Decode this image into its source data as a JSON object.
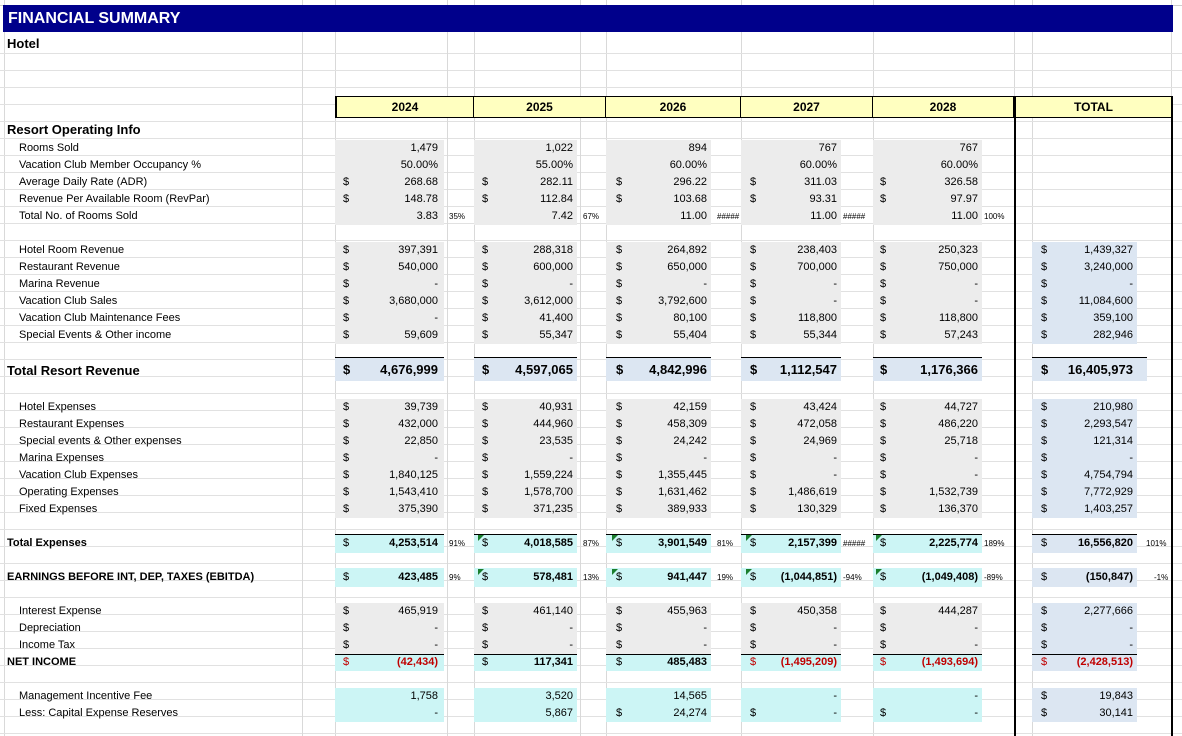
{
  "title": "FINANCIAL SUMMARY",
  "subtitle": "Hotel",
  "years": [
    "2024",
    "2025",
    "2026",
    "2027",
    "2028"
  ],
  "total_label": "TOTAL",
  "currency": "$",
  "section_operating": "Resort Operating Info",
  "operating": [
    {
      "label": "Rooms Sold",
      "values": [
        "1,479",
        "1,022",
        "894",
        "767",
        "767"
      ],
      "cur": false
    },
    {
      "label": "Vacation Club Member Occupancy %",
      "values": [
        "50.00%",
        "55.00%",
        "60.00%",
        "60.00%",
        "60.00%"
      ],
      "cur": false
    },
    {
      "label": "Average Daily Rate (ADR)",
      "values": [
        "268.68",
        "282.11",
        "296.22",
        "311.03",
        "326.58"
      ],
      "cur": true
    },
    {
      "label": "Revenue Per Available Room (RevPar)",
      "values": [
        "148.78",
        "112.84",
        "103.68",
        "93.31",
        "97.97"
      ],
      "cur": true
    },
    {
      "label": "Total No. of Rooms Sold",
      "values": [
        "3.83",
        "7.42",
        "11.00",
        "11.00",
        "11.00"
      ],
      "cur": false,
      "pcts": [
        "35%",
        "67%",
        "#####",
        "#####",
        "100%"
      ]
    }
  ],
  "revenue": [
    {
      "label": "Hotel Room Revenue",
      "values": [
        "397,391",
        "288,318",
        "264,892",
        "238,403",
        "250,323"
      ],
      "total": "1,439,327"
    },
    {
      "label": "Restaurant Revenue",
      "values": [
        "540,000",
        "600,000",
        "650,000",
        "700,000",
        "750,000"
      ],
      "total": "3,240,000"
    },
    {
      "label": "Marina Revenue",
      "values": [
        "-",
        "-",
        "-",
        "-",
        "-"
      ],
      "total": "-"
    },
    {
      "label": "Vacation Club Sales",
      "values": [
        "3,680,000",
        "3,612,000",
        "3,792,600",
        "-",
        "-"
      ],
      "total": "11,084,600"
    },
    {
      "label": "Vacation Club Maintenance Fees",
      "values": [
        "-",
        "41,400",
        "80,100",
        "118,800",
        "118,800"
      ],
      "total": "359,100"
    },
    {
      "label": "Special Events & Other income",
      "values": [
        "59,609",
        "55,347",
        "55,404",
        "55,344",
        "57,243"
      ],
      "total": "282,946"
    }
  ],
  "total_revenue": {
    "label": "Total Resort Revenue",
    "values": [
      "4,676,999",
      "4,597,065",
      "4,842,996",
      "1,112,547",
      "1,176,366"
    ],
    "total": "16,405,973"
  },
  "expenses": [
    {
      "label": "Hotel Expenses",
      "values": [
        "39,739",
        "40,931",
        "42,159",
        "43,424",
        "44,727"
      ],
      "total": "210,980"
    },
    {
      "label": "Restaurant Expenses",
      "values": [
        "432,000",
        "444,960",
        "458,309",
        "472,058",
        "486,220"
      ],
      "total": "2,293,547"
    },
    {
      "label": "Special events & Other expenses",
      "values": [
        "22,850",
        "23,535",
        "24,242",
        "24,969",
        "25,718"
      ],
      "total": "121,314"
    },
    {
      "label": "Marina Expenses",
      "values": [
        "-",
        "-",
        "-",
        "-",
        "-"
      ],
      "total": "-"
    },
    {
      "label": "Vacation Club Expenses",
      "values": [
        "1,840,125",
        "1,559,224",
        "1,355,445",
        "-",
        "-"
      ],
      "total": "4,754,794"
    },
    {
      "label": "Operating Expenses",
      "values": [
        "1,543,410",
        "1,578,700",
        "1,631,462",
        "1,486,619",
        "1,532,739"
      ],
      "total": "7,772,929"
    },
    {
      "label": "Fixed Expenses",
      "values": [
        "375,390",
        "371,235",
        "389,933",
        "130,329",
        "136,370"
      ],
      "total": "1,403,257"
    }
  ],
  "total_expenses": {
    "label": "Total Expenses",
    "values": [
      "4,253,514",
      "4,018,585",
      "3,901,549",
      "2,157,399",
      "2,225,774"
    ],
    "pcts": [
      "91%",
      "87%",
      "81%",
      "#####",
      "189%"
    ],
    "total": "16,556,820",
    "total_pct": "101%"
  },
  "ebitda": {
    "label": "EARNINGS BEFORE INT, DEP, TAXES (EBITDA)",
    "values": [
      "423,485",
      "578,481",
      "941,447",
      "(1,044,851)",
      "(1,049,408)"
    ],
    "pcts": [
      "9%",
      "13%",
      "19%",
      "-94%",
      "-89%"
    ],
    "total": "(150,847)",
    "total_pct": "-1%"
  },
  "below": [
    {
      "label": "Interest Expense",
      "values": [
        "465,919",
        "461,140",
        "455,963",
        "450,358",
        "444,287"
      ],
      "total": "2,277,666"
    },
    {
      "label": "Depreciation",
      "values": [
        "-",
        "-",
        "-",
        "-",
        "-"
      ],
      "total": "-"
    },
    {
      "label": "Income Tax",
      "values": [
        "-",
        "-",
        "-",
        "-",
        "-"
      ],
      "total": "-"
    }
  ],
  "net_income": {
    "label": "NET INCOME",
    "values": [
      "(42,434)",
      "117,341",
      "485,483",
      "(1,495,209)",
      "(1,493,694)"
    ],
    "total": "(2,428,513)"
  },
  "fees": [
    {
      "label": "Management Incentive Fee",
      "values": [
        "1,758",
        "3,520",
        "14,565",
        "-",
        "-"
      ],
      "total": "19,843",
      "curs": [
        false,
        false,
        false,
        false,
        false
      ]
    },
    {
      "label": "Less: Capital Expense Reserves",
      "values": [
        "-",
        "5,867",
        "24,274",
        "-",
        "-"
      ],
      "total": "30,141",
      "curs": [
        false,
        false,
        true,
        true,
        true
      ]
    }
  ],
  "colors": {
    "title_bg": "#00008b",
    "header_bg": "#ffffc0",
    "negative": "#c00000",
    "cyan_cell": "#ccf5f5",
    "total_cell": "#dce6f2"
  }
}
